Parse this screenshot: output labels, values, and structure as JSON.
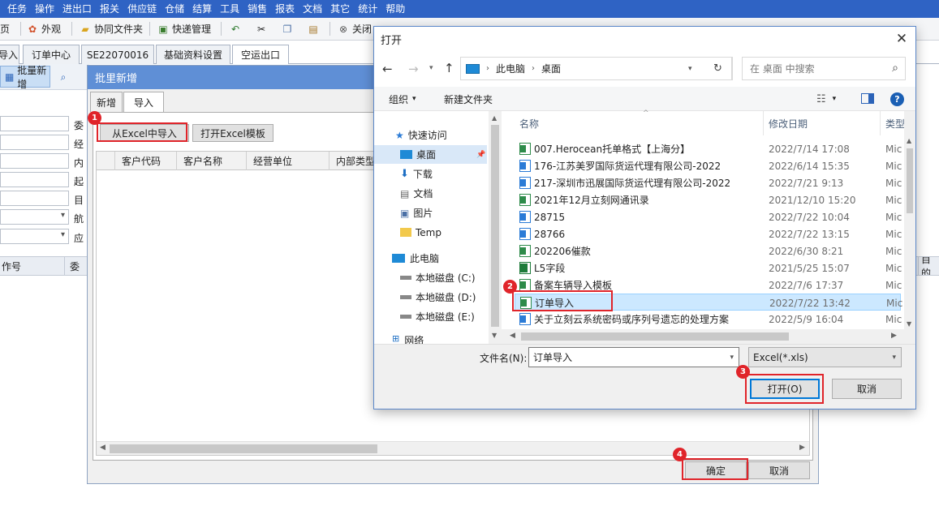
{
  "menu": [
    "任务",
    "操作",
    "进出口",
    "报关",
    "供应链",
    "仓储",
    "结算",
    "工具",
    "销售",
    "报表",
    "文档",
    "其它",
    "统计",
    "帮助"
  ],
  "toolbar": {
    "home": "主页",
    "appearance": "外观",
    "collab_files": "协同文件夹",
    "express": "快递管理",
    "close": "关闭"
  },
  "tabs": [
    "导入",
    "订单中心",
    "SE22070016",
    "基础资料设置",
    "空运出口"
  ],
  "subtool": {
    "batch_add": "批量新增"
  },
  "left_labels": [
    "委",
    "经",
    "内",
    "起",
    "目",
    "航",
    "应"
  ],
  "left_grid": {
    "col1": "作号",
    "col2": "委"
  },
  "right_grid": {
    "col1": "目的"
  },
  "batch": {
    "title": "批里新增",
    "tab_new": "新增",
    "tab_import": "导入",
    "btn_from_excel": "从Excel中导入",
    "btn_open_template": "打开Excel模板",
    "columns": [
      "客户代码",
      "客户名称",
      "经营单位",
      "内部类型"
    ],
    "ok": "确定",
    "cancel": "取消"
  },
  "open_dialog": {
    "title": "打开",
    "breadcrumb": [
      "此电脑",
      "桌面"
    ],
    "search_placeholder": "在 桌面 中搜索",
    "organize": "组织",
    "new_folder": "新建文件夹",
    "nav": [
      {
        "label": "快速访问",
        "icon": "star-icon"
      },
      {
        "label": "桌面",
        "icon": "desktop-icon"
      },
      {
        "label": "下载",
        "icon": "download-icon"
      },
      {
        "label": "文档",
        "icon": "document-icon"
      },
      {
        "label": "图片",
        "icon": "picture-icon"
      },
      {
        "label": "Temp",
        "icon": "folder-icon"
      },
      {
        "label": "此电脑",
        "icon": "computer-icon"
      },
      {
        "label": "本地磁盘 (C:)",
        "icon": "drive-icon"
      },
      {
        "label": "本地磁盘 (D:)",
        "icon": "drive-icon"
      },
      {
        "label": "本地磁盘 (E:)",
        "icon": "drive-icon"
      },
      {
        "label": "网络",
        "icon": "network-icon"
      }
    ],
    "col_name": "名称",
    "col_date": "修改日期",
    "col_type": "类型",
    "files": [
      {
        "name": "007.Herocean托单格式【上海分】",
        "date": "2022/7/14 17:08",
        "type": "Mic",
        "kind": "excel"
      },
      {
        "name": "176-江苏美罗国际货运代理有限公司-2022",
        "date": "2022/6/14 15:35",
        "type": "Mic",
        "kind": "word"
      },
      {
        "name": "217-深圳市迅展国际货运代理有限公司-2022",
        "date": "2022/7/21 9:13",
        "type": "Mic",
        "kind": "word"
      },
      {
        "name": "2021年12月立刻网通讯录",
        "date": "2021/12/10 15:20",
        "type": "Mic",
        "kind": "excel"
      },
      {
        "name": "28715",
        "date": "2022/7/22 10:04",
        "type": "Mic",
        "kind": "word"
      },
      {
        "name": "28766",
        "date": "2022/7/22 13:15",
        "type": "Mic",
        "kind": "word"
      },
      {
        "name": "202206催款",
        "date": "2022/6/30 8:21",
        "type": "Mic",
        "kind": "excel"
      },
      {
        "name": "L5字段",
        "date": "2021/5/25 15:07",
        "type": "Mic",
        "kind": "xlsx"
      },
      {
        "name": "备案车辆导入模板",
        "date": "2022/7/6 17:37",
        "type": "Mic",
        "kind": "excel"
      },
      {
        "name": "订单导入",
        "date": "2022/7/22 13:42",
        "type": "Mic",
        "kind": "excel"
      },
      {
        "name": "关于立刻云系统密码或序列号遗忘的处理方案",
        "date": "2022/5/9 16:04",
        "type": "Mic",
        "kind": "word"
      }
    ],
    "filename_label": "文件名(N):",
    "filename_value": "订单导入",
    "filter": "Excel(*.xls)",
    "open_btn": "打开(O)",
    "cancel_btn": "取消"
  },
  "annotations": [
    "1",
    "2",
    "3",
    "4"
  ]
}
